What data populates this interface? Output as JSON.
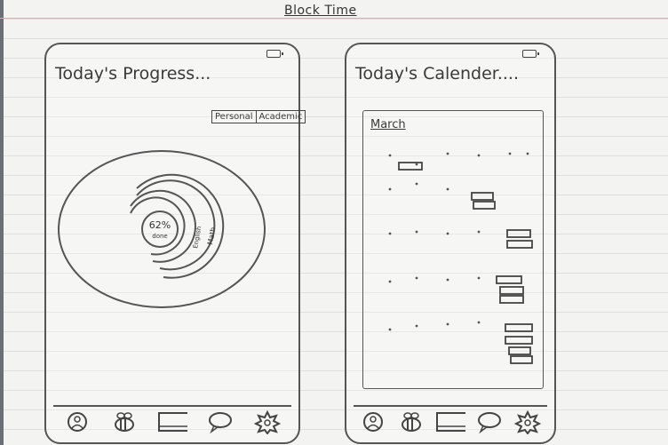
{
  "title": "Block Time",
  "left_screen": {
    "title": "Today's Progress...",
    "toggle": [
      "Personal",
      "Academic"
    ],
    "percent_value": "62%",
    "percent_caption": "done",
    "ring_labels": [
      "English",
      "Math"
    ]
  },
  "right_screen": {
    "title": "Today's Calender....",
    "month": "March"
  },
  "nav_icons": [
    "profile-icon",
    "bee-icon",
    "calendar-icon",
    "chat-icon",
    "settings-icon"
  ]
}
